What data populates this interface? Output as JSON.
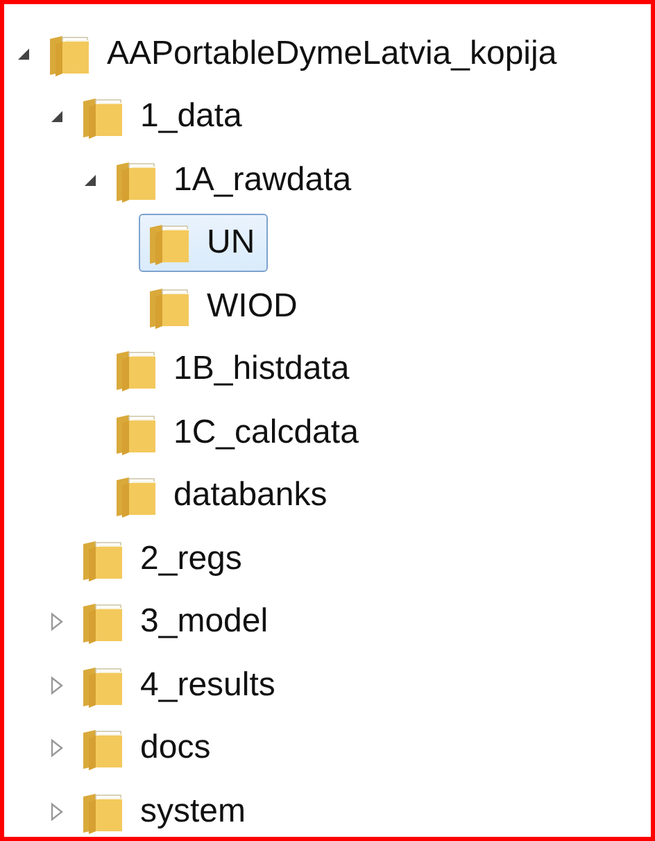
{
  "tree": [
    {
      "label": "AAPortableDymeLatvia_kopija",
      "kind": "branch",
      "expanded": true,
      "selected": false,
      "children": [
        {
          "label": "1_data",
          "kind": "branch",
          "expanded": true,
          "selected": false,
          "children": [
            {
              "label": "1A_rawdata",
              "kind": "branch",
              "expanded": true,
              "selected": false,
              "children": [
                {
                  "label": "UN",
                  "kind": "leaf",
                  "selected": true
                },
                {
                  "label": "WIOD",
                  "kind": "leaf",
                  "selected": false
                }
              ]
            },
            {
              "label": "1B_histdata",
              "kind": "leaf",
              "selected": false
            },
            {
              "label": "1C_calcdata",
              "kind": "leaf",
              "selected": false
            },
            {
              "label": "databanks",
              "kind": "leaf",
              "selected": false
            }
          ]
        },
        {
          "label": "2_regs",
          "kind": "leaf",
          "selected": false
        },
        {
          "label": "3_model",
          "kind": "branch",
          "expanded": false,
          "selected": false
        },
        {
          "label": "4_results",
          "kind": "branch",
          "expanded": false,
          "selected": false
        },
        {
          "label": "docs",
          "kind": "branch",
          "expanded": false,
          "selected": false
        },
        {
          "label": "system",
          "kind": "branch",
          "expanded": false,
          "selected": false
        }
      ]
    }
  ]
}
